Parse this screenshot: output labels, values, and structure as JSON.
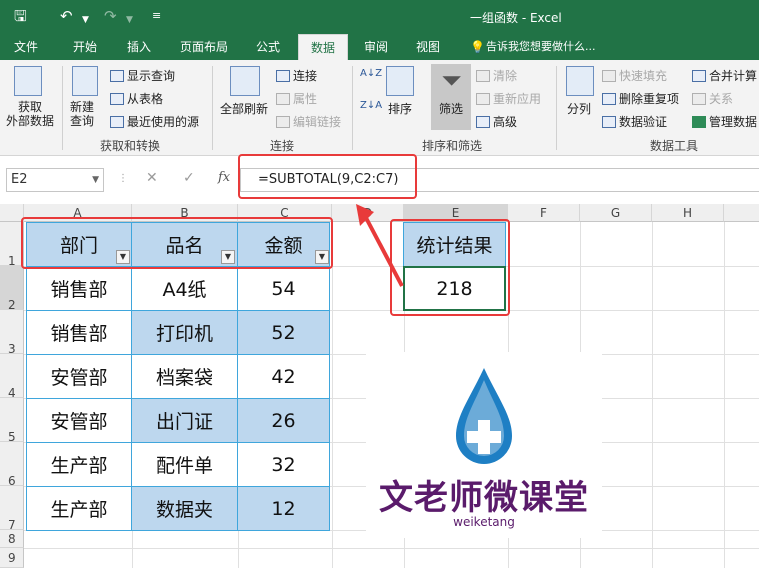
{
  "title_bar": {
    "title": "一组函数 - Excel"
  },
  "tabs": [
    "文件",
    "开始",
    "插入",
    "页面布局",
    "公式",
    "数据",
    "审阅",
    "视图"
  ],
  "active_tab": "数据",
  "tell_me": "告诉我您想要做什么...",
  "ribbon": {
    "get_external": "获取\n外部数据",
    "new_query": "新建\n查询",
    "show_queries": "显示查询",
    "from_table": "从表格",
    "recent_sources": "最近使用的源",
    "group_get": "获取和转换",
    "refresh_all": "全部刷新",
    "connections": "连接",
    "properties": "属性",
    "edit_links": "编辑链接",
    "group_connections": "连接",
    "sort": "排序",
    "filter": "筛选",
    "clear": "清除",
    "reapply": "重新应用",
    "advanced": "高级",
    "group_sort": "排序和筛选",
    "split": "分列",
    "flash_fill": "快速填充",
    "remove_dup": "删除重复项",
    "validation": "数据验证",
    "consolidate": "合并计算",
    "relationships": "关系",
    "manage_model": "管理数据",
    "group_tools": "数据工具"
  },
  "formula_bar": {
    "name_box": "E2",
    "formula": "=SUBTOTAL(9,C2:C7)"
  },
  "columns": [
    "A",
    "B",
    "C",
    "D",
    "E",
    "F",
    "G",
    "H"
  ],
  "rows": [
    "1",
    "2",
    "3",
    "4",
    "5",
    "6",
    "7",
    "8",
    "9"
  ],
  "table": {
    "headers": [
      "部门",
      "品名",
      "金额"
    ],
    "rows": [
      [
        "销售部",
        "A4纸",
        "54"
      ],
      [
        "销售部",
        "打印机",
        "52"
      ],
      [
        "安管部",
        "档案袋",
        "42"
      ],
      [
        "安管部",
        "出门证",
        "26"
      ],
      [
        "生产部",
        "配件单",
        "32"
      ],
      [
        "生产部",
        "数据夹",
        "12"
      ]
    ]
  },
  "result": {
    "header": "统计结果",
    "value": "218"
  },
  "watermark": {
    "brand": "文老师微课堂",
    "sub": "weiketang"
  },
  "colors": {
    "accent": "#217346",
    "highlight": "#e83a3a",
    "header_fill": "#bdd7ee",
    "cell_border": "#3fa6dc"
  }
}
